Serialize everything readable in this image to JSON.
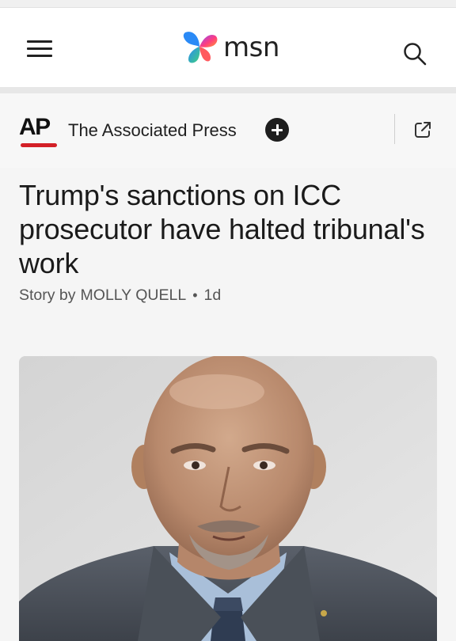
{
  "app": {
    "brand": "msn",
    "brand_colors": {
      "blue": "#2a8af6",
      "purple": "#8a4bff",
      "pink": "#ff3d7f",
      "orange": "#ff9a2e",
      "green": "#3ed07e"
    }
  },
  "header": {
    "menu_icon": "hamburger-menu-icon",
    "search_icon": "search-icon"
  },
  "source": {
    "logo_text": "AP",
    "logo_accent": "#d32027",
    "name": "The Associated Press",
    "follow_icon": "plus-circle-icon",
    "share_icon": "open-external-icon"
  },
  "article": {
    "headline": "Trump's sanctions on ICC prosecutor have halted tribunal's work",
    "byline_prefix": "Story by",
    "author": "MOLLY QUELL",
    "separator": "•",
    "age": "1d"
  }
}
